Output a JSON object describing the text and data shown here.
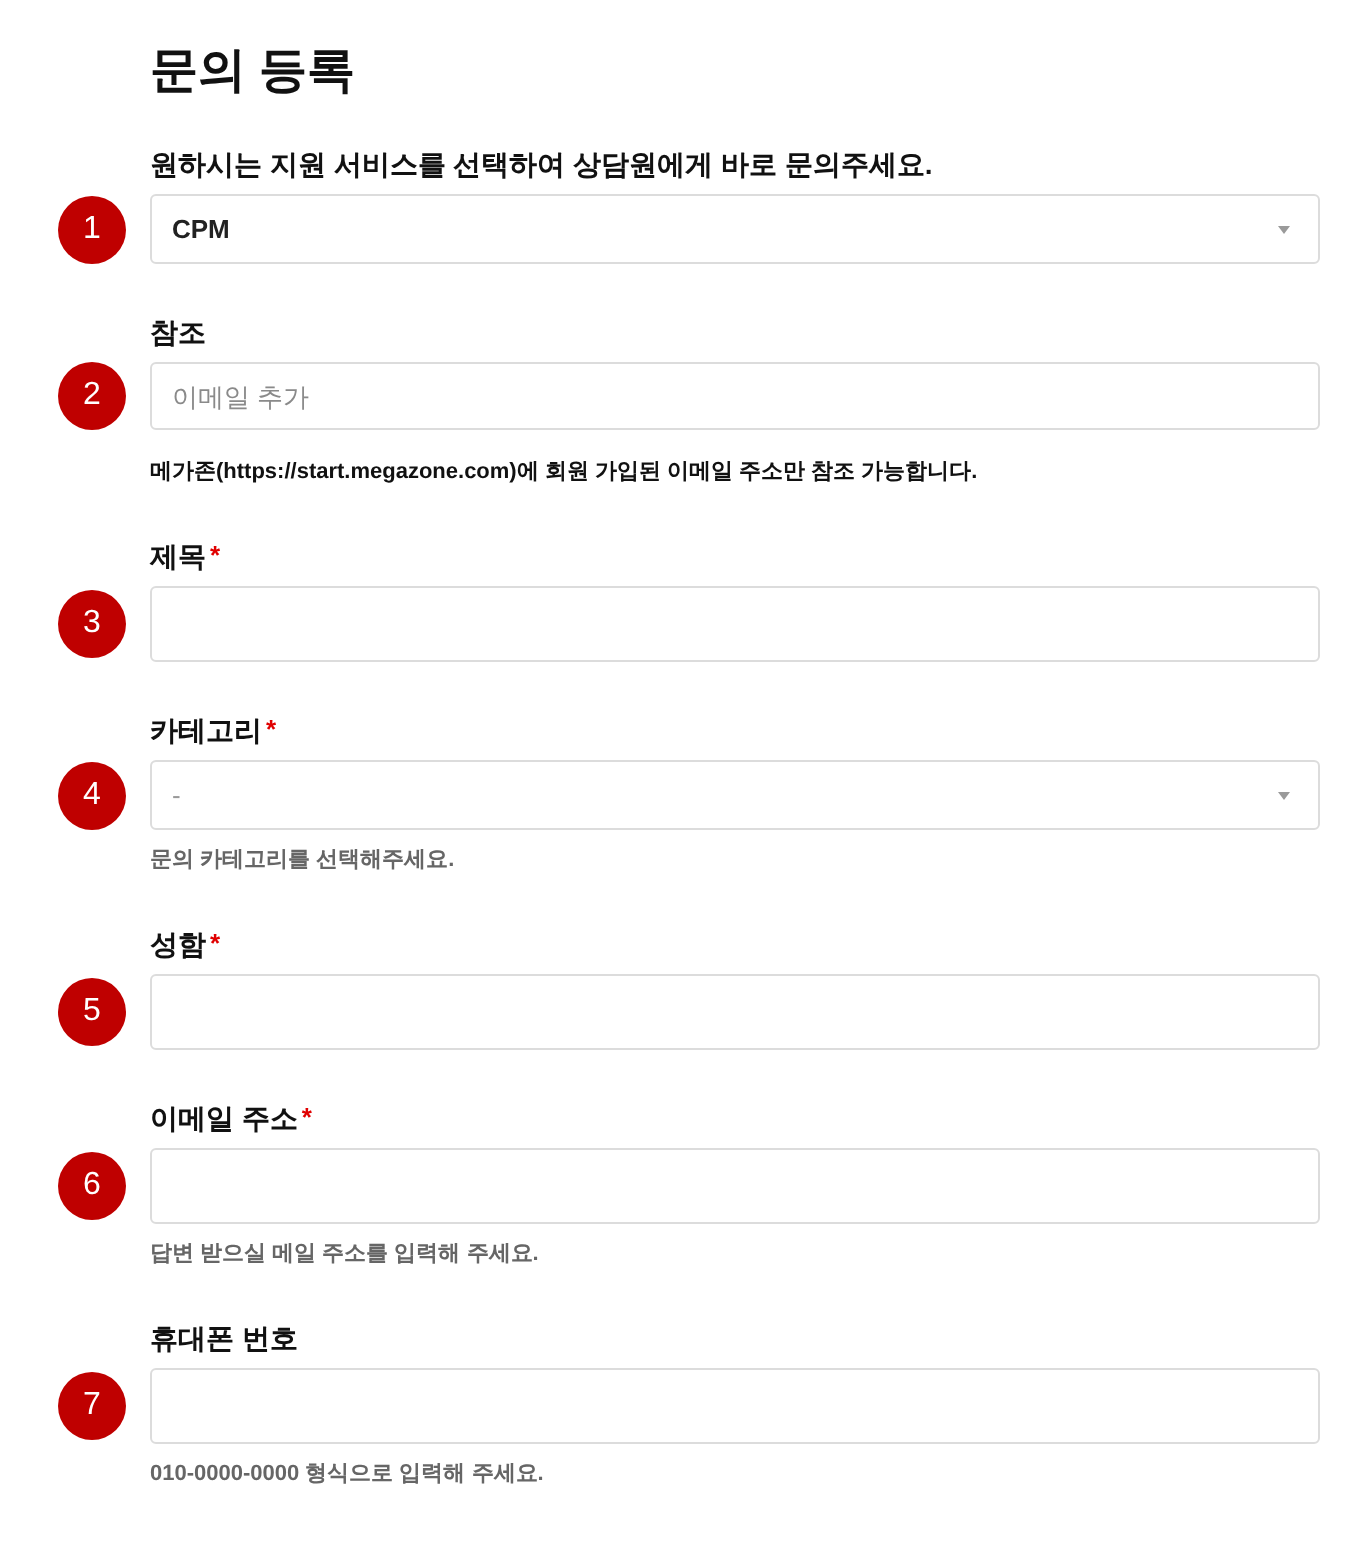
{
  "title": "문의 등록",
  "fields": [
    {
      "marker": "1",
      "label": "원하시는 지원 서비스를 선택하여 상담원에게 바로 문의주세요.",
      "kind": "select",
      "value": "CPM"
    },
    {
      "marker": "2",
      "label": "참조",
      "kind": "tags",
      "placeholder": "이메일 추가",
      "help": {
        "text": "메가존(https://start.megazone.com)에 회원 가입된 이메일 주소만 참조 가능합니다.",
        "emphasized": true
      }
    },
    {
      "marker": "3",
      "label": "제목",
      "required_mark": "*",
      "kind": "text"
    },
    {
      "marker": "4",
      "label": "카테고리",
      "required_mark": "*",
      "kind": "select",
      "placeholder": "-",
      "help": {
        "text": "문의 카테고리를 선택해주세요.",
        "emphasized": false
      }
    },
    {
      "marker": "5",
      "label": "성함",
      "required_mark": "*",
      "kind": "text"
    },
    {
      "marker": "6",
      "label": "이메일 주소",
      "required_mark": "*",
      "kind": "text",
      "help": {
        "text": "답변 받으실 메일 주소를 입력해 주세요.",
        "emphasized": false
      }
    },
    {
      "marker": "7",
      "label": "휴대폰 번호",
      "kind": "text",
      "help": {
        "text": "010-0000-0000 형식으로 입력해 주세요.",
        "emphasized": false
      }
    }
  ]
}
